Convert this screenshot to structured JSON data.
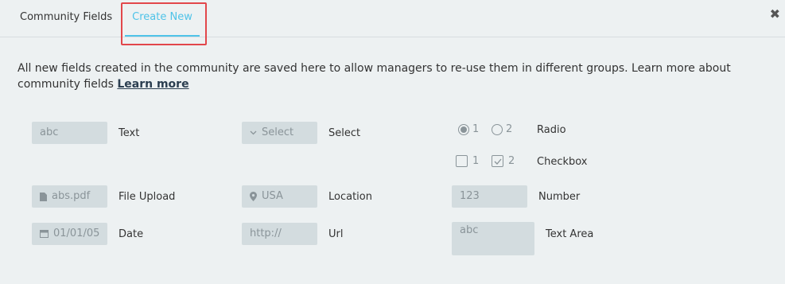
{
  "tabs": {
    "community_fields": "Community Fields",
    "create_new": "Create New"
  },
  "description": {
    "text": "All new fields created in the community are saved here to allow managers to re-use them in different groups. Learn more about community fields ",
    "link": "Learn more"
  },
  "fields": {
    "text": {
      "value": "abc",
      "label": "Text"
    },
    "select": {
      "value": "Select",
      "label": "Select"
    },
    "radio": {
      "option1": "1",
      "option2": "2",
      "label": "Radio",
      "selected": "1"
    },
    "checkbox": {
      "option1": "1",
      "option2": "2",
      "label": "Checkbox",
      "checked": [
        "2"
      ]
    },
    "file_upload": {
      "value": "abs.pdf",
      "label": "File Upload"
    },
    "location": {
      "value": "USA",
      "label": "Location"
    },
    "number": {
      "value": "123",
      "label": "Number"
    },
    "date": {
      "value": "01/01/05",
      "label": "Date"
    },
    "url": {
      "value": "http://",
      "label": "Url"
    },
    "text_area": {
      "value": "abc",
      "label": "Text Area"
    }
  },
  "icons": {
    "close": "close-icon",
    "select": "chevron-down-icon",
    "file": "file-icon",
    "location": "map-pin-icon",
    "date": "calendar-icon"
  },
  "colors": {
    "accent": "#4fc3e8",
    "highlight_border": "#e2474b",
    "field_background": "#d3dcdf",
    "page_background": "#edf1f2"
  }
}
